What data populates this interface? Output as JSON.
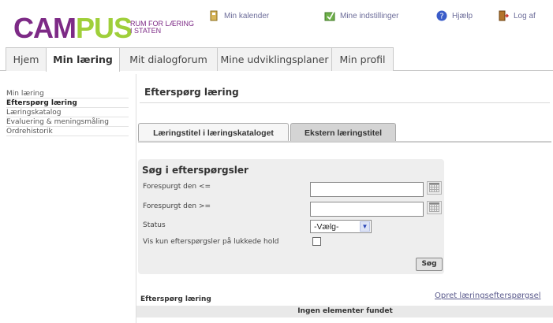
{
  "brand": {
    "logo_part1": "CAM",
    "logo_part2": "PUS",
    "tagline_line1": "RUM FOR LÆRING",
    "tagline_line2": "I STATEN"
  },
  "top_links": {
    "calendar": "Min kalender",
    "settings": "Mine indstillinger",
    "help": "Hjælp",
    "logout": "Log af"
  },
  "main_tabs": [
    {
      "label": "Hjem",
      "active": false
    },
    {
      "label": "Min læring",
      "active": true
    },
    {
      "label": "Mit dialogforum",
      "active": false
    },
    {
      "label": "Mine udviklingsplaner",
      "active": false
    },
    {
      "label": "Min profil",
      "active": false
    }
  ],
  "sidebar": {
    "items": [
      {
        "label": "Min læring",
        "active": false
      },
      {
        "label": "Efterspørg læring",
        "active": true
      },
      {
        "label": "Læringskatalog",
        "active": false
      },
      {
        "label": "Evaluering & meningsmåling",
        "active": false
      },
      {
        "label": "Ordrehistorik",
        "active": false
      }
    ]
  },
  "page": {
    "title": "Efterspørg læring",
    "subtabs": [
      {
        "label": "Læringstitel i læringskataloget",
        "active": true
      },
      {
        "label": "Ekstern læringstitel",
        "active": false
      }
    ]
  },
  "search": {
    "title": "Søg i efterspørgsler",
    "requested_before_label": "Forespurgt den <=",
    "requested_before_value": "",
    "requested_after_label": "Forespurgt den >=",
    "requested_after_value": "",
    "status_label": "Status",
    "status_selected": "-Vælg-",
    "closed_only_label": "Vis kun efterspørgsler på lukkede hold",
    "closed_only_checked": false,
    "search_button": "Søg"
  },
  "results": {
    "title": "Efterspørg læring",
    "create_link": "Opret læringsefterspørgsel",
    "empty_message": "Ingen elementer fundet"
  },
  "colors": {
    "brand_purple": "#7d2a86",
    "brand_green": "#9fcf3a",
    "link_color": "#5a5a8c"
  }
}
